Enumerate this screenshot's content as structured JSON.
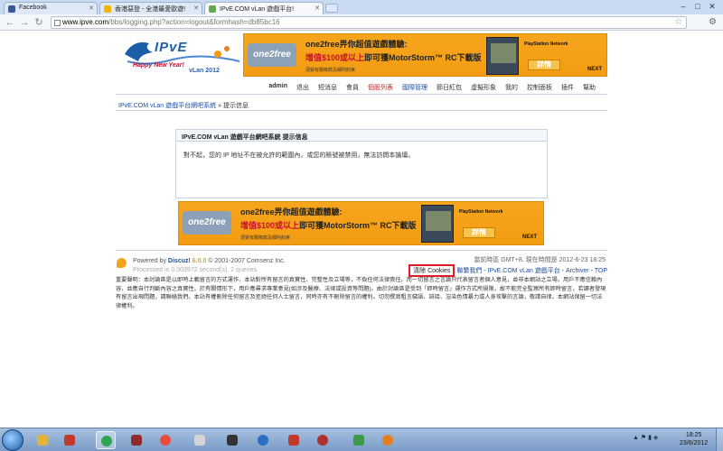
{
  "browser": {
    "tabs": [
      {
        "title": "Facebook",
        "icon_color": "#3b5998",
        "active": false
      },
      {
        "title": "香港惡登 - 全港最愛歐遊!",
        "icon_color": "#f4b400",
        "active": false
      },
      {
        "title": "IPvE.COM vLan 遊戲平台!",
        "icon_color": "#6aa84f",
        "active": true
      }
    ],
    "url_host": "www.ipve.com",
    "url_rest": "/bbs/logging.php?action=logout&formhash=db85bc16"
  },
  "site": {
    "logo_text": "IPvE",
    "logo_ny": "Happy New Year!",
    "logo_vlan": "vLan 2012",
    "ad": {
      "logo": "one2free",
      "line1": "one2free畀你超值遊戲體驗:",
      "line2_red": "增值$100或以上",
      "line2_rest": "即可獲MotorStorm™ RC下載版",
      "line3": "須受有關條款及細則約束",
      "platform": "PlayStation Network",
      "more": "詳情",
      "brand": "NEXT"
    },
    "nav": [
      {
        "label": "admin",
        "style": "bold"
      },
      {
        "label": "退出",
        "style": ""
      },
      {
        "label": "短消息",
        "style": ""
      },
      {
        "label": "會員",
        "style": ""
      },
      {
        "label": "個股列表",
        "style": "red"
      },
      {
        "label": "國際管理",
        "style": "blue"
      },
      {
        "label": "節日紅包",
        "style": ""
      },
      {
        "label": "虛擬形象",
        "style": ""
      },
      {
        "label": "我的",
        "style": ""
      },
      {
        "label": "控制面板",
        "style": ""
      },
      {
        "label": "插件",
        "style": ""
      },
      {
        "label": "幫助",
        "style": ""
      }
    ],
    "breadcrumb": {
      "home": "IPvE.COM vLan 遊戲平台網吧系統",
      "sep": "»",
      "current": "提示信息"
    },
    "message": {
      "title": "IPvE.COM vLan 遊戲平台網吧系統 提示信息",
      "body": "對不起，您的 IP 地址不在被允許的範圍內，或您的賬號被禁用，無法訪問本論壇。"
    },
    "footer": {
      "powered_prefix": "Powered by",
      "brand": "Discuz!",
      "version": "6.0.0",
      "copyright": "© 2001-2007 Comsenz Inc.",
      "processed": "Processed in 0.003972 second(s), 2 queries.",
      "time": "當前時區 GMT+8, 現在時間是 2012-6-23 18:25",
      "cookie_btn": "清除 Cookies",
      "contact": "聯繫我們",
      "site_name": "IPvE.COM vLan 遊戲平台",
      "archiver": "Archiver",
      "top": "TOP",
      "disclaimer": "重要聲明：本討論區是以即時上載留言的方式運作，本站對所有留言的真實性、完整性及立場等，不負任何法律責任。而一切留言之言論只代表留言者個人意見，並非本網站之立場，用戶不應信賴內容，並應自行判斷內容之真實性。於有關情形下，用戶應尋求專業意見(如涉及醫療、法律或投資等問題)。由於討論區是受到「即時留言」運作方式所規限，故不能完全監察所有即時留言，若讀者發現有留言出現問題，請聯絡我們。本站有權刪除任何留言及拒絕任何人士留言，同時亦有不刪除留言的權利。切勿撰寫粗言穢語、誹謗、渲染色情暴力或人身攻擊的言論，敬請自律。本網站保留一切法律權利。"
    }
  },
  "taskbar": {
    "clock_time": "18:25",
    "clock_date": "23/6/2012"
  }
}
